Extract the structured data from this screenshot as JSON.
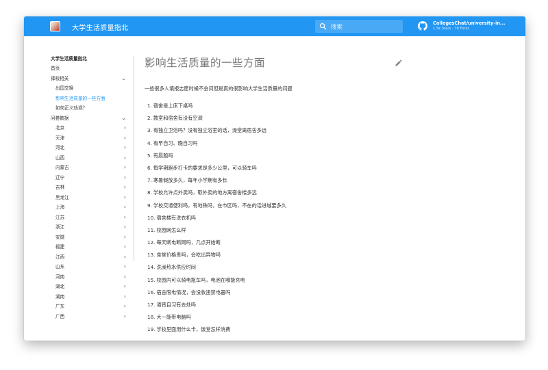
{
  "header": {
    "site_title": "大学生活质量指北",
    "search_placeholder": "搜索",
    "repo_name": "CollegesChat/university-in...",
    "repo_facts": "1.5k Stars · 78 Forks"
  },
  "sidebar": {
    "title": "大学生活质量指北",
    "items": [
      {
        "label": "首页",
        "level": 0,
        "chevron": ""
      },
      {
        "label": "择校相关",
        "level": 0,
        "chevron": "⌄"
      },
      {
        "label": "出国交换",
        "level": 1,
        "chevron": ""
      },
      {
        "label": "影响生活质量的一些方面",
        "level": 1,
        "chevron": "",
        "active": true
      },
      {
        "label": "如何正义劝退？",
        "level": 1,
        "chevron": ""
      },
      {
        "label": "问卷数据",
        "level": 0,
        "chevron": "⌄"
      },
      {
        "label": "北京",
        "level": 1,
        "chevron": "›"
      },
      {
        "label": "天津",
        "level": 1,
        "chevron": "›"
      },
      {
        "label": "河北",
        "level": 1,
        "chevron": "›"
      },
      {
        "label": "山西",
        "level": 1,
        "chevron": "›"
      },
      {
        "label": "内蒙古",
        "level": 1,
        "chevron": "›"
      },
      {
        "label": "辽宁",
        "level": 1,
        "chevron": "›"
      },
      {
        "label": "吉林",
        "level": 1,
        "chevron": "›"
      },
      {
        "label": "黑龙江",
        "level": 1,
        "chevron": "›"
      },
      {
        "label": "上海",
        "level": 1,
        "chevron": "›"
      },
      {
        "label": "江苏",
        "level": 1,
        "chevron": "›"
      },
      {
        "label": "浙江",
        "level": 1,
        "chevron": "›"
      },
      {
        "label": "安徽",
        "level": 1,
        "chevron": "›"
      },
      {
        "label": "福建",
        "level": 1,
        "chevron": "›"
      },
      {
        "label": "江西",
        "level": 1,
        "chevron": "›"
      },
      {
        "label": "山东",
        "level": 1,
        "chevron": "›"
      },
      {
        "label": "河南",
        "level": 1,
        "chevron": "›"
      },
      {
        "label": "湖北",
        "level": 1,
        "chevron": "›"
      },
      {
        "label": "湖南",
        "level": 1,
        "chevron": "›"
      },
      {
        "label": "广东",
        "level": 1,
        "chevron": "›"
      },
      {
        "label": "广西",
        "level": 1,
        "chevron": "›"
      }
    ]
  },
  "main": {
    "page_title": "影响生活质量的一些方面",
    "intro": "一些很多人填报志愿时候不会问但是真的很影响大学生活质量的问题",
    "questions": [
      "宿舍是上床下桌吗",
      "教室和宿舍有没有空调",
      "有独立卫浴吗？没有独立浴室的话，澡堂离宿舍多远",
      "有早自习、晚自习吗",
      "有晨跑吗",
      "每学期跑步打卡的要求是多少公里，可以骑车吗",
      "寒暑假放多久，每年小学期有多长",
      "学校允许点外卖吗，取外卖的地方离宿舍楼多远",
      "学校交通便利吗，有地铁吗，在市区吗，不在的话进城要多久",
      "宿舍楼有洗衣机吗",
      "校园网怎么样",
      "每天断电断网吗，几点开始断",
      "食堂价格贵吗，会吃出异物吗",
      "洗澡热水供应时间",
      "校园内可以骑电瓶车吗，电池在哪能充电",
      "宿舍限电情况，会没收违禁电器吗",
      "通宵自习有去处吗",
      "大一能带电脑吗",
      "学校里面用什么卡，饭堂怎样消费"
    ]
  },
  "icons": {
    "search": "search-icon",
    "github": "github-icon",
    "edit": "pencil-icon"
  },
  "colors": {
    "header": "#2196f3",
    "active_link": "#2196f3"
  }
}
